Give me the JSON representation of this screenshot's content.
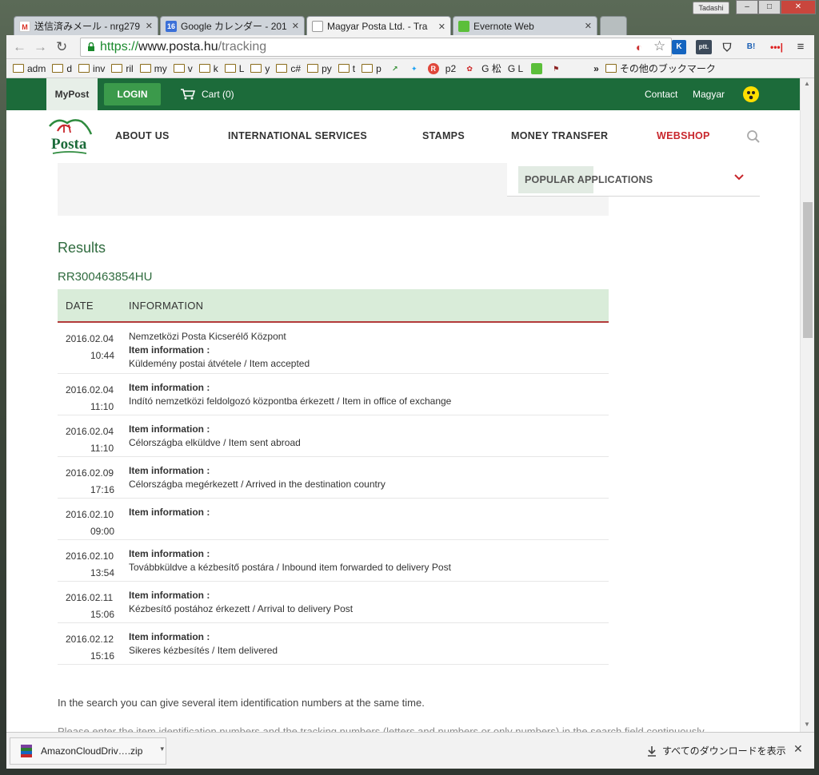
{
  "browser": {
    "profile": "Tadashi",
    "tabs": [
      {
        "title": "送信済みメール - nrg279",
        "icon": "gmail-icon",
        "favicon_text": "M"
      },
      {
        "title": "Google カレンダー - 201",
        "icon": "calendar-icon",
        "favicon_text": "16"
      },
      {
        "title": "Magyar Posta Ltd. - Tra",
        "icon": "posta-icon",
        "favicon_text": ""
      },
      {
        "title": "Evernote Web",
        "icon": "evernote-icon",
        "favicon_text": ""
      }
    ],
    "url": {
      "scheme": "https://",
      "host": "www.posta.hu",
      "path": "/tracking"
    },
    "bookmarks": [
      "adm",
      "d",
      "inv",
      "ril",
      "my",
      "v",
      "k",
      "L",
      "y",
      "c#",
      "py",
      "t",
      "p"
    ],
    "bookmark_icons": [
      "p2",
      "G 松",
      "G L"
    ],
    "other_bookmarks": "その他のブックマーク",
    "extensions": [
      "K",
      "ptt.",
      "B!"
    ]
  },
  "site": {
    "mypost": "MyPost",
    "login": "LOGIN",
    "cart": "Cart (0)",
    "contact": "Contact",
    "language": "Magyar",
    "logo_text": "Posta",
    "nav": [
      "ABOUT US",
      "INTERNATIONAL SERVICES",
      "STAMPS",
      "MONEY TRANSFER",
      "WEBSHOP"
    ],
    "popular": "POPULAR APPLICATIONS",
    "accent": "#1c6b3a",
    "webshop_color": "#c8262c"
  },
  "results": {
    "heading": "Results",
    "tracking_number": "RR300463854HU",
    "columns": {
      "date": "DATE",
      "info": "INFORMATION"
    },
    "rows": [
      {
        "date": "2016.02.04",
        "time": "10:44",
        "location": "Nemzetközi Posta Kicserélő Központ",
        "label": "Item information :",
        "detail": "Küldemény postai átvétele / Item accepted"
      },
      {
        "date": "2016.02.04",
        "time": "11:10",
        "location": "",
        "label": "Item information :",
        "detail": "Indító nemzetközi feldolgozó központba érkezett / Item in office of exchange"
      },
      {
        "date": "2016.02.04",
        "time": "11:10",
        "location": "",
        "label": "Item information :",
        "detail": "Célországba elküldve / Item sent abroad"
      },
      {
        "date": "2016.02.09",
        "time": "17:16",
        "location": "",
        "label": "Item information :",
        "detail": "Célországba megérkezett / Arrived in the destination country"
      },
      {
        "date": "2016.02.10",
        "time": "09:00",
        "location": "",
        "label": "Item information :",
        "detail": ""
      },
      {
        "date": "2016.02.10",
        "time": "13:54",
        "location": "",
        "label": "Item information :",
        "detail": "Továbbküldve a kézbesítő postára / Inbound item forwarded to delivery Post"
      },
      {
        "date": "2016.02.11",
        "time": "15:06",
        "location": "",
        "label": "Item information :",
        "detail": "Kézbesítő postához érkezett / Arrival to delivery Post"
      },
      {
        "date": "2016.02.12",
        "time": "15:16",
        "location": "",
        "label": "Item information :",
        "detail": "Sikeres kézbesítés / Item delivered"
      }
    ],
    "help1": "In the search you can give several item identification numbers at the same time.",
    "help2": "Please enter the item identification numbers and the tracking numbers (letters and numbers or only numbers) in the search field continuously"
  },
  "downloads": {
    "file": "AmazonCloudDriv….zip",
    "show_all": "すべてのダウンロードを表示"
  }
}
